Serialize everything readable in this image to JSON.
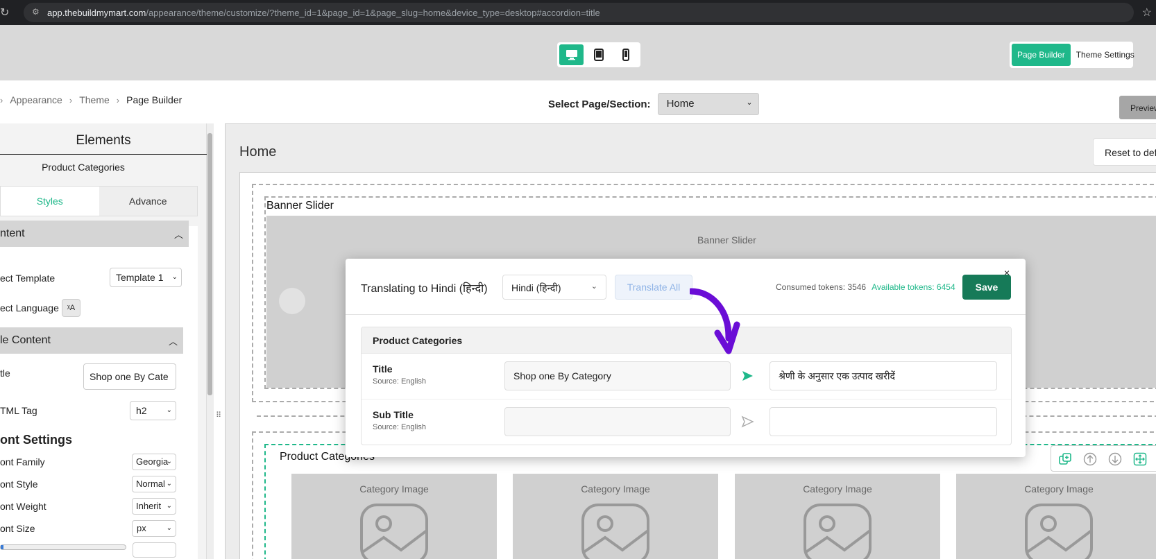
{
  "browser": {
    "url_domain": "app.thebuildmymart.com",
    "url_path": "/appearance/theme/customize/?theme_id=1&page_id=1&page_slug=home&device_type=desktop#accordion=title"
  },
  "toolbar": {
    "devices": [
      "desktop-icon",
      "tablet-icon",
      "mobile-icon"
    ],
    "active_device": "desktop",
    "mode_page_builder": "Page Builder",
    "mode_theme_settings": "Theme Settings"
  },
  "breadcrumb": {
    "items": [
      "Appearance",
      "Theme",
      "Page Builder"
    ]
  },
  "page_select": {
    "label": "Select Page/Section:",
    "value": "Home"
  },
  "preview_label": "Preview",
  "left_panel": {
    "title": "Elements",
    "subtitle": "Product Categories",
    "tab_styles": "Styles",
    "tab_advance": "Advance",
    "acc_content": "ntent",
    "select_template_label": "ect Template",
    "select_template_value": "Template 1",
    "select_language_label": "ect Language",
    "acc_title_content": "le Content",
    "title_label": "tle",
    "title_value": "Shop one By Cate",
    "html_tag_label": "TML Tag",
    "html_tag_value": "h2",
    "font_settings": "ont Settings",
    "font_family_label": "ont Family",
    "font_family_value": "Georgia",
    "font_style_label": "ont Style",
    "font_style_value": "Normal",
    "font_weight_label": "ont Weight",
    "font_weight_value": "Inherit",
    "font_size_label": "ont Size",
    "font_size_value": "px"
  },
  "canvas": {
    "title": "Home",
    "reset_label": "Reset to def",
    "banner_section_label": "Banner Slider",
    "banner_inner_label": "Banner Slider",
    "categories_label": "Product Categories",
    "category_item_label": "Category Image",
    "category_count": 4
  },
  "modal": {
    "title": "Translating to Hindi (हिन्दी)",
    "language_value": "Hindi (हिन्दी)",
    "translate_all": "Translate All",
    "consumed_tokens": "Consumed tokens: 3546",
    "available_tokens": "Available tokens: 6454",
    "save_label": "Save",
    "close": "×",
    "section_header": "Product Categories",
    "rows": [
      {
        "field": "Title",
        "source": "Source: English",
        "original": "Shop one By Category",
        "translated": "श्रेणी के अनुसार एक उत्पाद खरीदें"
      },
      {
        "field": "Sub Title",
        "source": "Source: English",
        "original": "",
        "translated": ""
      }
    ]
  },
  "colors": {
    "accent": "#1fb88a",
    "save": "#167a58",
    "annotation_arrow": "#6a0dd6"
  }
}
